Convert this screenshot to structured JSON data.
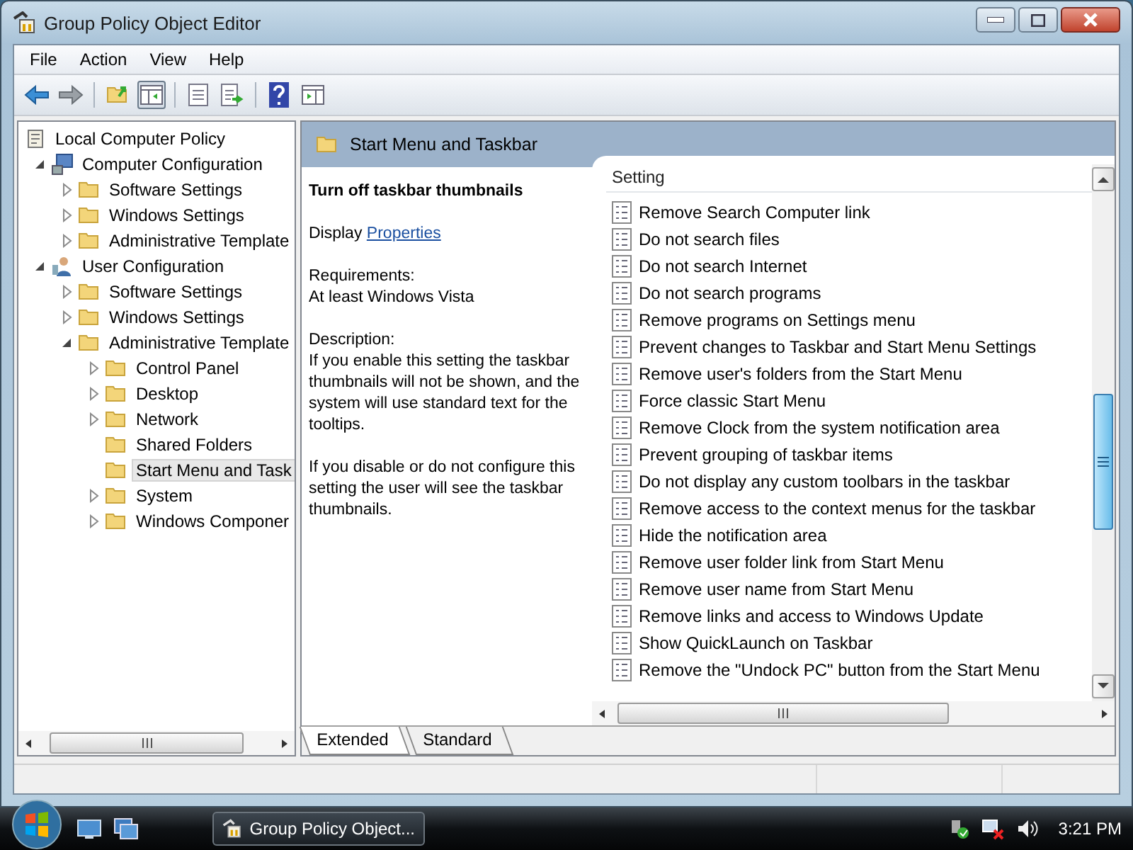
{
  "window": {
    "title": "Group Policy Object Editor"
  },
  "menu": [
    "File",
    "Action",
    "View",
    "Help"
  ],
  "tree": [
    {
      "label": "Local Computer Policy",
      "kind": "policy",
      "selected": false,
      "children": [
        {
          "label": "Computer Configuration",
          "kind": "computer",
          "expanded": true,
          "selected": false,
          "children": [
            {
              "label": "Software Settings",
              "kind": "folder",
              "expanded": false,
              "selected": false
            },
            {
              "label": "Windows Settings",
              "kind": "folder",
              "expanded": false,
              "selected": false
            },
            {
              "label": "Administrative Template",
              "kind": "folder",
              "expanded": false,
              "selected": false
            }
          ]
        },
        {
          "label": "User Configuration",
          "kind": "user",
          "expanded": true,
          "selected": false,
          "children": [
            {
              "label": "Software Settings",
              "kind": "folder",
              "expanded": false,
              "selected": false
            },
            {
              "label": "Windows Settings",
              "kind": "folder",
              "expanded": false,
              "selected": false
            },
            {
              "label": "Administrative Template",
              "kind": "folder",
              "expanded": true,
              "selected": false,
              "children": [
                {
                  "label": "Control Panel",
                  "kind": "folder",
                  "expanded": false,
                  "selected": false
                },
                {
                  "label": "Desktop",
                  "kind": "folder",
                  "expanded": false,
                  "selected": false
                },
                {
                  "label": "Network",
                  "kind": "folder",
                  "expanded": false,
                  "selected": false
                },
                {
                  "label": "Shared Folders",
                  "kind": "folder",
                  "selected": false
                },
                {
                  "label": "Start Menu and Task",
                  "kind": "folder",
                  "selected": true
                },
                {
                  "label": "System",
                  "kind": "folder",
                  "expanded": false,
                  "selected": false
                },
                {
                  "label": "Windows Componer",
                  "kind": "folder",
                  "expanded": false,
                  "selected": false
                }
              ]
            }
          ]
        }
      ]
    }
  ],
  "header": {
    "title": "Start Menu and Taskbar"
  },
  "description": {
    "title": "Turn off taskbar thumbnails",
    "display_label": "Display",
    "display_link": "Properties",
    "requirements_label": "Requirements:",
    "requirements": "At least Windows Vista",
    "description_label": "Description:",
    "paragraphs": [
      "If you enable this setting the taskbar thumbnails will not be shown, and the system will use standard text for the tooltips.",
      "If you disable or do not configure this setting the user will see the taskbar thumbnails."
    ]
  },
  "settings": {
    "column": "Setting",
    "rows": [
      "Remove Search Computer link",
      "Do not search files",
      "Do not search Internet",
      "Do not search programs",
      "Remove programs on Settings menu",
      "Prevent changes to Taskbar and Start Menu Settings",
      "Remove user's folders from the Start Menu",
      "Force classic Start Menu",
      "Remove Clock from the system notification area",
      "Prevent grouping of taskbar items",
      "Do not display any custom toolbars in the taskbar",
      "Remove access to the context menus for the taskbar",
      "Hide the notification area",
      "Remove user folder link from Start Menu",
      "Remove user name from Start Menu",
      "Remove links and access to Windows Update",
      "Show QuickLaunch on Taskbar",
      "Remove the \"Undock PC\" button from the Start Menu"
    ]
  },
  "tabs": [
    {
      "label": "Extended",
      "selected": true
    },
    {
      "label": "Standard",
      "selected": false
    }
  ],
  "taskbar": {
    "task": "Group Policy Object...",
    "clock": "3:21 PM"
  }
}
